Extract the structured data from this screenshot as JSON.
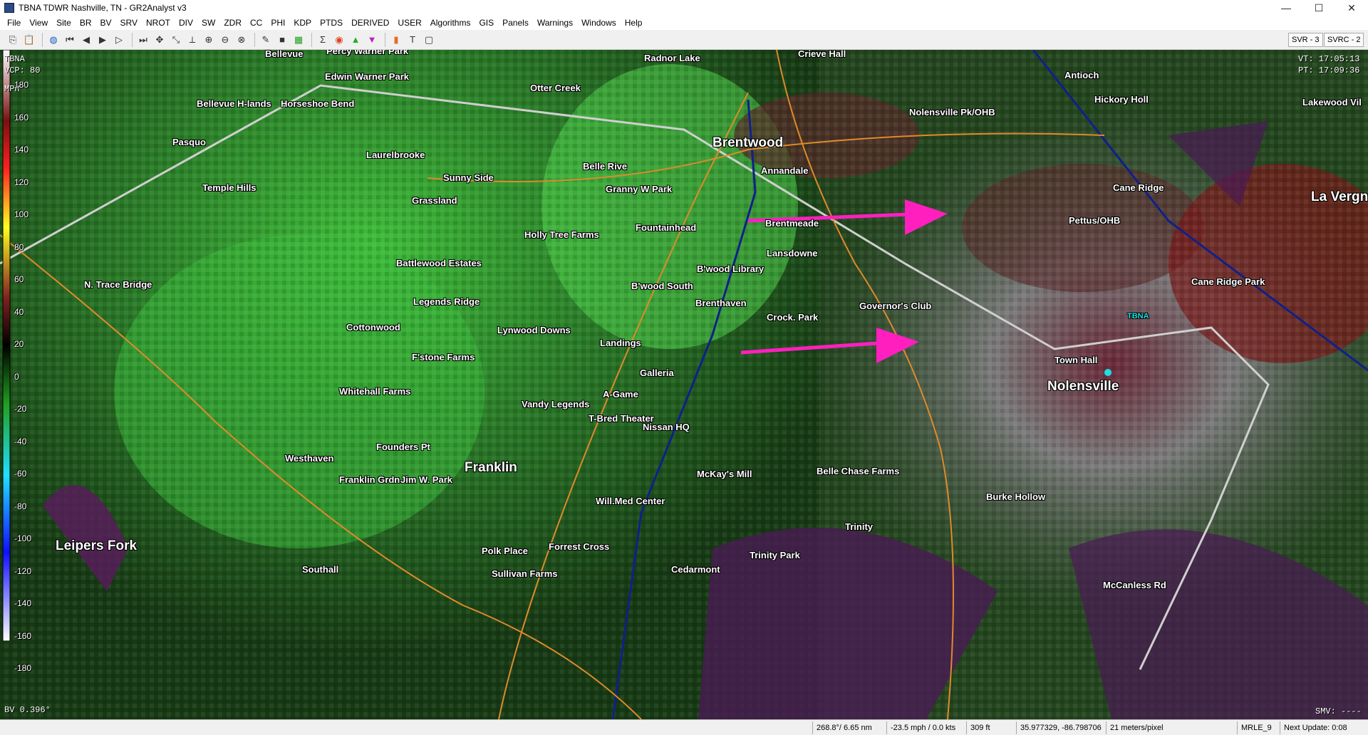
{
  "window": {
    "title": "TBNA TDWR Nashville, TN - GR2Analyst v3",
    "minimize": "—",
    "maximize": "☐",
    "close": "✕"
  },
  "menu": [
    "File",
    "View",
    "Site",
    "BR",
    "BV",
    "SRV",
    "NROT",
    "DIV",
    "SW",
    "ZDR",
    "CC",
    "PHI",
    "KDP",
    "PTDS",
    "DERIVED",
    "USER",
    "Algorithms",
    "GIS",
    "Panels",
    "Warnings",
    "Windows",
    "Help"
  ],
  "toolbar": {
    "buttons": [
      "copy-icon",
      "paste-icon",
      "globe-icon",
      "first-frame-icon",
      "prev-frame-icon",
      "play-icon",
      "next-frame-icon",
      "last-frame-icon",
      "pan-icon",
      "measure-icon",
      "cross-section-icon",
      "zoom-in-icon",
      "zoom-out-icon",
      "reset-zoom-icon",
      "picker-icon",
      "stop-icon",
      "grid-icon",
      "sigma-icon",
      "radar-icon",
      "triangle-up-icon",
      "triangle-down-icon",
      "layer-icon",
      "text-icon",
      "frame-icon"
    ],
    "svr_button": "SVR - 3",
    "svrc_button": "SVRC - 2"
  },
  "hud": {
    "site": "TBNA",
    "vcp": "VCP: 80",
    "unit": "MPH",
    "vt": "VT: 17:05:13",
    "pt": "PT: 17:09:36",
    "product": "BV 0.396°",
    "smv": "SMV: ----"
  },
  "colorbar": {
    "labels": [
      "180",
      "160",
      "140",
      "120",
      "100",
      "80",
      "60",
      "40",
      "20",
      "0",
      "-20",
      "-40",
      "-60",
      "-80",
      "-100",
      "-120",
      "-140",
      "-160",
      "-180"
    ],
    "range_fold": "rf"
  },
  "places": [
    {
      "name": "Percy Warner Park",
      "big": false
    },
    {
      "name": "Bellevue",
      "big": false
    },
    {
      "name": "Radnor Lake",
      "big": false
    },
    {
      "name": "Crieve Hall",
      "big": false
    },
    {
      "name": "Antioch",
      "big": false
    },
    {
      "name": "Edwin Warner Park",
      "big": false
    },
    {
      "name": "Otter Creek",
      "big": false
    },
    {
      "name": "Hickory Holl",
      "big": false
    },
    {
      "name": "Lakewood Vil",
      "big": false
    },
    {
      "name": "Bellevue H-lands",
      "big": false
    },
    {
      "name": "Horseshoe Bend",
      "big": false
    },
    {
      "name": "Nolensville Pk/OHB",
      "big": false
    },
    {
      "name": "Pasquo",
      "big": false
    },
    {
      "name": "Brentwood",
      "big": true
    },
    {
      "name": "Laurelbrooke",
      "big": false
    },
    {
      "name": "Belle Rive",
      "big": false
    },
    {
      "name": "Annandale",
      "big": false
    },
    {
      "name": "Sunny Side",
      "big": false
    },
    {
      "name": "Temple Hills",
      "big": false
    },
    {
      "name": "Granny W Park",
      "big": false
    },
    {
      "name": "Cane Ridge",
      "big": false
    },
    {
      "name": "La Vergne",
      "big": true
    },
    {
      "name": "Grassland",
      "big": false
    },
    {
      "name": "Pettus/OHB",
      "big": false
    },
    {
      "name": "Fountainhead",
      "big": false
    },
    {
      "name": "Brentmeade",
      "big": false
    },
    {
      "name": "Holly Tree Farms",
      "big": false
    },
    {
      "name": "Lansdowne",
      "big": false
    },
    {
      "name": "Battlewood Estates",
      "big": false
    },
    {
      "name": "B'wood Library",
      "big": false
    },
    {
      "name": "Cane Ridge Park",
      "big": false
    },
    {
      "name": "N. Trace Bridge",
      "big": false
    },
    {
      "name": "B'wood South",
      "big": false
    },
    {
      "name": "Legends Ridge",
      "big": false
    },
    {
      "name": "Brenthaven",
      "big": false
    },
    {
      "name": "Governor's Club",
      "big": false
    },
    {
      "name": "Crock. Park",
      "big": false
    },
    {
      "name": "TBNA",
      "big": false
    },
    {
      "name": "Cottonwood",
      "big": false
    },
    {
      "name": "Lynwood Downs",
      "big": false
    },
    {
      "name": "Landings",
      "big": false
    },
    {
      "name": "F'stone Farms",
      "big": false
    },
    {
      "name": "Town Hall",
      "big": false
    },
    {
      "name": "Galleria",
      "big": false
    },
    {
      "name": "Nolensville",
      "big": true
    },
    {
      "name": "Whitehall Farms",
      "big": false
    },
    {
      "name": "A-Game",
      "big": false
    },
    {
      "name": "Vandy Legends",
      "big": false
    },
    {
      "name": "T-Bred Theater",
      "big": false
    },
    {
      "name": "Nissan HQ",
      "big": false
    },
    {
      "name": "Founders Pt",
      "big": false
    },
    {
      "name": "Westhaven",
      "big": false
    },
    {
      "name": "Franklin",
      "big": true
    },
    {
      "name": "McKay's Mill",
      "big": false
    },
    {
      "name": "Belle Chase Farms",
      "big": false
    },
    {
      "name": "Franklin Grdn",
      "big": false
    },
    {
      "name": "Jim W. Park",
      "big": false
    },
    {
      "name": "Will.Med Center",
      "big": false
    },
    {
      "name": "Burke Hollow",
      "big": false
    },
    {
      "name": "Trinity",
      "big": false
    },
    {
      "name": "Leipers Fork",
      "big": true
    },
    {
      "name": "Polk Place",
      "big": false
    },
    {
      "name": "Forrest Cross",
      "big": false
    },
    {
      "name": "Trinity Park",
      "big": false
    },
    {
      "name": "Southall",
      "big": false
    },
    {
      "name": "Cedarmont",
      "big": false
    },
    {
      "name": "Sullivan Farms",
      "big": false
    },
    {
      "name": "McCanless Rd",
      "big": false
    }
  ],
  "status": {
    "polar": "268.8°/ 6.65 nm",
    "velocity": "-23.5 mph / 0.0 kts",
    "height": "309 ft",
    "latlon": "35.977329, -86.798706",
    "resolution": "21 meters/pixel",
    "mrle": "MRLE_9",
    "update": "Next Update: 0:08"
  },
  "colors": {
    "arrow": "#ff1fbf",
    "radar_site": "#1fe0e0"
  }
}
